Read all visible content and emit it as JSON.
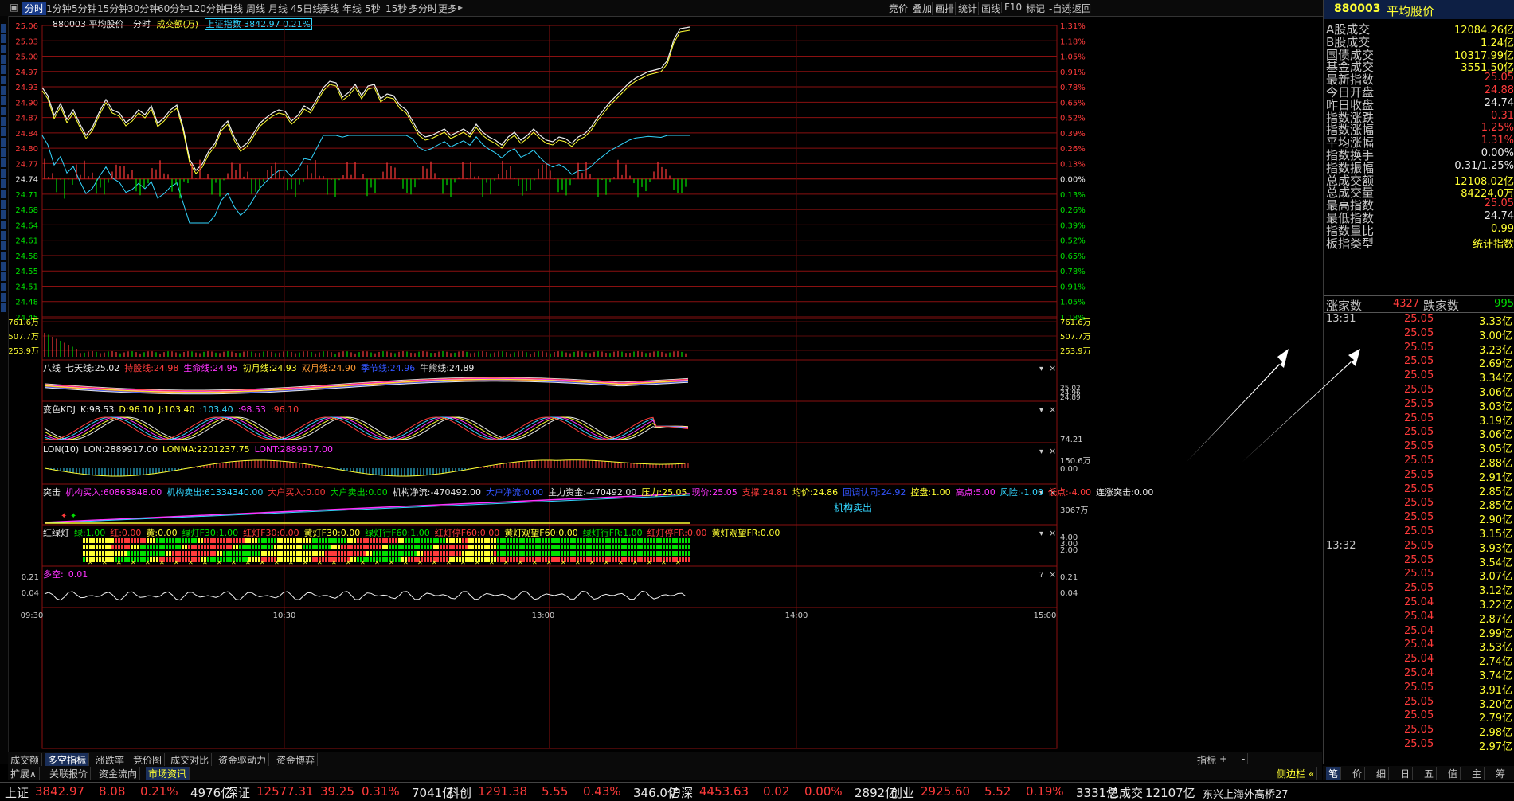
{
  "toolbar": {
    "periods": [
      "分时",
      "1分钟",
      "5分钟",
      "15分钟",
      "30分钟",
      "60分钟",
      "120分钟",
      "日线",
      "周线",
      "月线",
      "45日线",
      "季线",
      "年线",
      "5秒",
      "15秒",
      "多分时",
      "更多"
    ],
    "active_period": "分时",
    "right_buttons": [
      "竞价",
      "叠加",
      "画排",
      "统计",
      "画线",
      "F10",
      "标记",
      "-自选",
      "返回"
    ]
  },
  "chart_header": {
    "code_name": "880003 平均股价",
    "mode": "分时",
    "volume_label": "成交额(万)",
    "overlay": "上证指数",
    "overlay_value": "3842.97",
    "overlay_pct": "0.21%"
  },
  "price_axis_left": [
    "25.06",
    "25.03",
    "25.00",
    "24.97",
    "24.93",
    "24.90",
    "24.87",
    "24.84",
    "24.80",
    "24.77",
    "24.74",
    "24.71",
    "24.68",
    "24.64",
    "24.61",
    "24.58",
    "24.55",
    "24.51",
    "24.48",
    "24.45"
  ],
  "price_axis_right": [
    "1.31%",
    "1.18%",
    "1.05%",
    "0.91%",
    "0.78%",
    "0.65%",
    "0.52%",
    "0.39%",
    "0.26%",
    "0.13%",
    "0.00%",
    "0.13%",
    "0.26%",
    "0.39%",
    "0.52%",
    "0.65%",
    "0.78%",
    "0.91%",
    "1.05%",
    "1.18%"
  ],
  "volume_axis": [
    "761.6万",
    "507.7万",
    "253.9万"
  ],
  "time_axis": [
    "09:30",
    "10:30",
    "13:00",
    "14:00",
    "15:00"
  ],
  "indicators": {
    "bagua": {
      "title": "八线",
      "items": [
        {
          "label": "七天线:",
          "value": "25.02",
          "color": "#e8e8e8"
        },
        {
          "label": "持股线:",
          "value": "24.98",
          "color": "#ff3b3b"
        },
        {
          "label": "生命线:",
          "value": "24.95",
          "color": "#ff33ff"
        },
        {
          "label": "初月线:",
          "value": "24.93",
          "color": "#ffff33"
        },
        {
          "label": "双月线:",
          "value": "24.90",
          "color": "#ff9933"
        },
        {
          "label": "季节线:",
          "value": "24.96",
          "color": "#3355ff"
        },
        {
          "label": "牛熊线:",
          "value": "24.89",
          "color": "#e8e8e8"
        }
      ],
      "axis": [
        "25.02",
        "24.96",
        "24.89"
      ]
    },
    "kdj": {
      "title": "变色KDJ",
      "items": [
        {
          "label": "K:",
          "value": "98.53",
          "color": "#e8e8e8"
        },
        {
          "label": "D:",
          "value": "96.10",
          "color": "#ffff33"
        },
        {
          "label": "J:",
          "value": "103.40",
          "color": "#ffff33"
        },
        {
          "label": ":",
          "value": "103.40",
          "color": "#33d6ff"
        },
        {
          "label": ":",
          "value": "98.53",
          "color": "#ff33ff"
        },
        {
          "label": ":",
          "value": "96.10",
          "color": "#ff3b3b"
        }
      ],
      "axis": [
        "74.21"
      ]
    },
    "lon": {
      "title": "LON(10)",
      "items": [
        {
          "label": "LON:",
          "value": "2889917.00",
          "color": "#e8e8e8"
        },
        {
          "label": "LONMA:",
          "value": "2201237.75",
          "color": "#ffff33"
        },
        {
          "label": "LONT:",
          "value": "2889917.00",
          "color": "#ff33ff"
        }
      ],
      "axis": [
        "150.6万",
        "0.00"
      ]
    },
    "tuji": {
      "title": "突击",
      "items": [
        {
          "label": "机构买入:",
          "value": "60863848.00",
          "color": "#ff33ff"
        },
        {
          "label": "机构卖出:",
          "value": "61334340.00",
          "color": "#33d6ff"
        },
        {
          "label": "大户买入:",
          "value": "0.00",
          "color": "#ff3b3b"
        },
        {
          "label": "大户卖出:",
          "value": "0.00",
          "color": "#00e000"
        },
        {
          "label": "机构净流:",
          "value": "-470492.00",
          "color": "#e8e8e8"
        },
        {
          "label": "大户净流:",
          "value": "0.00",
          "color": "#3355ff"
        },
        {
          "label": "主力资金:",
          "value": "-470492.00",
          "color": "#e8e8e8"
        },
        {
          "label": "压力:",
          "value": "25.05",
          "color": "#ffff33"
        },
        {
          "label": "现价:",
          "value": "25.05",
          "color": "#ff33ff"
        },
        {
          "label": "支撑:",
          "value": "24.81",
          "color": "#ff3b3b"
        },
        {
          "label": "均价:",
          "value": "24.86",
          "color": "#ffff33"
        },
        {
          "label": "回调认同:",
          "value": "24.92",
          "color": "#3355ff"
        },
        {
          "label": "控盘:",
          "value": "1.00",
          "color": "#ffff33"
        },
        {
          "label": "高点:",
          "value": "5.00",
          "color": "#ff33ff"
        },
        {
          "label": "风险:",
          "value": "-1.00",
          "color": "#33d6ff"
        },
        {
          "label": "低点:",
          "value": "-4.00",
          "color": "#ff3b3b"
        },
        {
          "label": "连涨突击:",
          "value": "0.00",
          "color": "#e8e8e8"
        }
      ],
      "annotation": "机构卖出",
      "axis": [
        "3067万"
      ]
    },
    "hld": {
      "title": "红绿灯",
      "items": [
        {
          "label": "绿:",
          "value": "1.00",
          "color": "#00e000"
        },
        {
          "label": "红:",
          "value": "0.00",
          "color": "#ff3b3b"
        },
        {
          "label": "黄:",
          "value": "0.00",
          "color": "#ffff33"
        },
        {
          "label": "绿灯F30:",
          "value": "1.00",
          "color": "#00e000"
        },
        {
          "label": "红灯F30:",
          "value": "0.00",
          "color": "#ff3b3b"
        },
        {
          "label": "黄灯F30:",
          "value": "0.00",
          "color": "#ffff33"
        },
        {
          "label": "绿灯行F60:",
          "value": "1.00",
          "color": "#00e000"
        },
        {
          "label": "红灯停F60:",
          "value": "0.00",
          "color": "#ff3b3b"
        },
        {
          "label": "黄灯观望F60:",
          "value": "0.00",
          "color": "#ffff33"
        },
        {
          "label": "绿灯行FR:",
          "value": "1.00",
          "color": "#00e000"
        },
        {
          "label": "红灯停FR:",
          "value": "0.00",
          "color": "#ff3b3b"
        },
        {
          "label": "黄灯观望FR:",
          "value": "0.00",
          "color": "#ffff33"
        }
      ],
      "axis": [
        "4.00",
        "3.00",
        "2.00"
      ]
    },
    "duokong": {
      "title": "多空:",
      "value": "0.01",
      "axis": [
        "0.21",
        "0.04"
      ]
    }
  },
  "right_panel": {
    "title_code": "880003",
    "title_name": "平均股价",
    "kv": [
      {
        "label": "A股成交",
        "value": "12084.26亿",
        "color": "#ffff33"
      },
      {
        "label": "B股成交",
        "value": "1.24亿",
        "color": "#ffff33"
      },
      {
        "label": "国债成交",
        "value": "10317.99亿",
        "color": "#ffff33"
      },
      {
        "label": "基金成交",
        "value": "3551.50亿",
        "color": "#ffff33"
      },
      {
        "label": "最新指数",
        "value": "25.05",
        "color": "#ff3b3b"
      },
      {
        "label": "今日开盘",
        "value": "24.88",
        "color": "#ff3b3b"
      },
      {
        "label": "昨日收盘",
        "value": "24.74",
        "color": "#e8e8e8"
      },
      {
        "label": "指数涨跌",
        "value": "0.31",
        "color": "#ff3b3b"
      },
      {
        "label": "指数涨幅",
        "value": "1.25%",
        "color": "#ff3b3b"
      },
      {
        "label": "平均涨幅",
        "value": "1.31%",
        "color": "#ff3b3b"
      },
      {
        "label": "指数换手",
        "value": "0.00%",
        "color": "#e8e8e8"
      },
      {
        "label": "指数振幅",
        "value": "0.31/1.25%",
        "color": "#e8e8e8"
      },
      {
        "label": "总成交额",
        "value": "12108.02亿",
        "color": "#ffff33"
      },
      {
        "label": "总成交量",
        "value": "84224.0万",
        "color": "#ffff33"
      },
      {
        "label": "最高指数",
        "value": "25.05",
        "color": "#ff3b3b"
      },
      {
        "label": "最低指数",
        "value": "24.74",
        "color": "#e8e8e8"
      },
      {
        "label": "指数量比",
        "value": "0.99",
        "color": "#ffff33"
      },
      {
        "label": "板指类型",
        "value": "统计指数",
        "color": "#ffff33"
      }
    ],
    "up_label": "涨家数",
    "up_value": "4327",
    "down_label": "跌家数",
    "down_value": "995",
    "ticks_1331": {
      "time": "13:31",
      "rows": [
        {
          "p": "25.05",
          "v": "3.33亿"
        },
        {
          "p": "25.05",
          "v": "3.00亿"
        },
        {
          "p": "25.05",
          "v": "3.23亿"
        },
        {
          "p": "25.05",
          "v": "2.69亿"
        },
        {
          "p": "25.05",
          "v": "3.34亿"
        },
        {
          "p": "25.05",
          "v": "3.06亿"
        },
        {
          "p": "25.05",
          "v": "3.03亿"
        },
        {
          "p": "25.05",
          "v": "3.19亿"
        },
        {
          "p": "25.05",
          "v": "3.06亿"
        },
        {
          "p": "25.05",
          "v": "3.05亿"
        },
        {
          "p": "25.05",
          "v": "2.88亿"
        },
        {
          "p": "25.05",
          "v": "2.91亿"
        },
        {
          "p": "25.05",
          "v": "2.85亿"
        },
        {
          "p": "25.05",
          "v": "2.85亿"
        },
        {
          "p": "25.05",
          "v": "2.90亿"
        },
        {
          "p": "25.05",
          "v": "3.15亿"
        }
      ]
    },
    "ticks_1332": {
      "time": "13:32",
      "rows": [
        {
          "p": "25.05",
          "v": "3.93亿"
        },
        {
          "p": "25.05",
          "v": "3.54亿"
        },
        {
          "p": "25.05",
          "v": "3.07亿"
        },
        {
          "p": "25.05",
          "v": "3.12亿"
        },
        {
          "p": "25.04",
          "v": "3.22亿"
        },
        {
          "p": "25.04",
          "v": "2.87亿"
        },
        {
          "p": "25.04",
          "v": "2.99亿"
        },
        {
          "p": "25.04",
          "v": "3.53亿"
        },
        {
          "p": "25.04",
          "v": "2.74亿"
        },
        {
          "p": "25.04",
          "v": "3.74亿"
        },
        {
          "p": "25.05",
          "v": "3.91亿"
        },
        {
          "p": "25.05",
          "v": "3.20亿"
        },
        {
          "p": "25.05",
          "v": "2.79亿"
        },
        {
          "p": "25.05",
          "v": "2.98亿"
        },
        {
          "p": "25.05",
          "v": "2.97亿"
        }
      ]
    },
    "bottom_tabs": [
      "笔",
      "价",
      "细",
      "日",
      "五",
      "值",
      "主",
      "筹"
    ]
  },
  "bottom_tabs_row1": [
    "成交额",
    "多空指标",
    "涨跌率",
    "竞价图",
    "成交对比",
    "资金驱动力",
    "资金博弈"
  ],
  "bottom_tabs_row1_active": "多空指标",
  "bottom_tabs_row1_right": [
    "指标",
    "+",
    "-"
  ],
  "bottom_tabs_row2": [
    "扩展∧",
    "关联报价",
    "资金流向",
    "市场资讯"
  ],
  "bottom_tabs_row2_right": "侧边栏 «",
  "status_bar": [
    {
      "name": "上证",
      "price": "3842.97",
      "chg": "8.08",
      "pct": "0.21%",
      "amt": "4976亿"
    },
    {
      "name": "深证",
      "price": "12577.31",
      "chg": "39.25",
      "pct": "0.31%",
      "amt": "7041亿"
    },
    {
      "name": "科创",
      "price": "1291.38",
      "chg": "5.55",
      "pct": "0.43%",
      "amt": "346.0亿"
    },
    {
      "name": "沪深",
      "price": "4453.63",
      "chg": "0.02",
      "pct": "0.00%",
      "amt": "2892亿"
    },
    {
      "name": "创业",
      "price": "2925.60",
      "chg": "5.52",
      "pct": "0.19%",
      "amt": "3331亿"
    }
  ],
  "status_total_label": "总成交",
  "status_total_value": "12107亿",
  "status_ticker": "东兴上海外高桥27"
}
